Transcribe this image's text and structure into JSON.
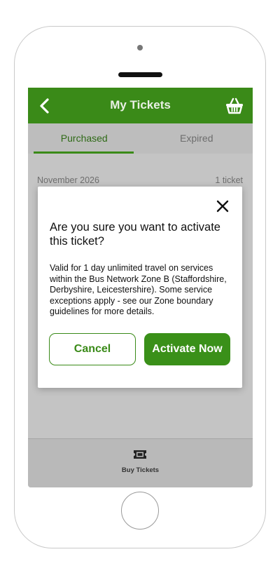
{
  "header": {
    "title": "My Tickets"
  },
  "tabs": [
    {
      "label": "Purchased",
      "active": true
    },
    {
      "label": "Expired",
      "active": false
    }
  ],
  "list": {
    "month": "November 2026",
    "count": "1 ticket"
  },
  "dialog": {
    "title": "Are you sure you want to activate this ticket?",
    "body": "Valid for 1 day unlimited travel on services within the Bus Network Zone B (Staffordshire, Derbyshire, Leicestershire). Some service exceptions apply - see our Zone boundary guidelines for more details.",
    "cancel_label": "Cancel",
    "activate_label": "Activate Now"
  },
  "footer": {
    "nav_label": "Buy Tickets",
    "nav_icon": "ticket-icon"
  },
  "colors": {
    "brand_green": "#3a8a18",
    "overlay_gray": "#c4c4c4"
  }
}
